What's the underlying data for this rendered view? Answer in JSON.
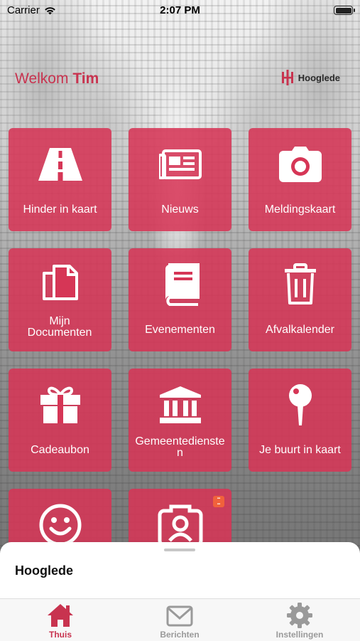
{
  "status_bar": {
    "carrier": "Carrier",
    "time": "2:07 PM"
  },
  "header": {
    "welcome_prefix": "Welkom",
    "user_name": "Tim",
    "brand_name": "Hooglede"
  },
  "tiles": [
    {
      "label": "Hinder in kaart",
      "icon": "road-icon"
    },
    {
      "label": "Nieuws",
      "icon": "newspaper-icon"
    },
    {
      "label": "Meldingskaart",
      "icon": "camera-icon"
    },
    {
      "label": "Mijn Documenten",
      "icon": "documents-icon"
    },
    {
      "label": "Evenementen",
      "icon": "book-icon"
    },
    {
      "label": "Afvalkalender",
      "icon": "trash-icon"
    },
    {
      "label": "Cadeaubon",
      "icon": "gift-icon"
    },
    {
      "label": "Gemeentediensten",
      "icon": "building-icon"
    },
    {
      "label": "Je buurt in kaart",
      "icon": "map-pin-icon"
    },
    {
      "label": "",
      "icon": "smiley-icon"
    },
    {
      "label": "",
      "icon": "id-photo-icon"
    }
  ],
  "bottom_sheet": {
    "title": "Hooglede"
  },
  "tab_bar": {
    "items": [
      {
        "label": "Thuis",
        "icon": "home-icon",
        "active": true
      },
      {
        "label": "Berichten",
        "icon": "mail-icon",
        "active": false
      },
      {
        "label": "Instellingen",
        "icon": "gear-icon",
        "active": false
      }
    ]
  },
  "colors": {
    "accent": "#c8334f",
    "tile": "#d63656",
    "inactive_tab": "#9a9a9a"
  }
}
